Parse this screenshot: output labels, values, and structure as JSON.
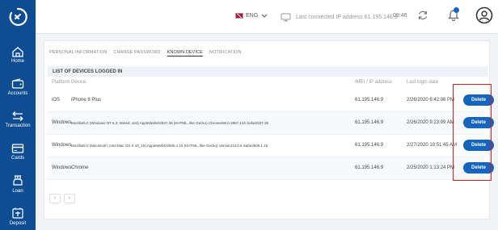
{
  "sidebar": {
    "items": [
      {
        "label": "Home",
        "icon": "home-icon"
      },
      {
        "label": "Accounts",
        "icon": "wallet-icon"
      },
      {
        "label": "Transaction",
        "icon": "transfer-icon"
      },
      {
        "label": "Cards",
        "icon": "card-icon"
      },
      {
        "label": "Loan",
        "icon": "loan-icon"
      },
      {
        "label": "Deposit",
        "icon": "deposit-icon"
      }
    ]
  },
  "header": {
    "language": "ENG",
    "last_connected_label": "Last connected IP address",
    "last_connected_ip": "61.195.146.9",
    "time": "09:46"
  },
  "tabs": [
    "PERSONAL INFORMATION",
    "CHANGE PASSWORD",
    "KNOWN DEVICE",
    "NOTIFICATION"
  ],
  "active_tab": "KNOWN DEVICE",
  "table": {
    "title": "LIST OF DEVICES LOGGED IN",
    "headers": [
      "Platform",
      "Device",
      "IMEI / IP address",
      "Last login date"
    ],
    "rows": [
      {
        "platform": "iOS",
        "device": "iPhone 8 Plus",
        "ip": "61.195.146.9",
        "last_login": "2/26/2020 6:42:08 PM",
        "action": "Delete"
      },
      {
        "platform": "Windows",
        "device": "Mozilla/5.0 (Windows NT 6.3; Win64; x64) AppleWebKit/537.36 (KHTML, like Gecko) Chrome/80.0.3987.122 Safari/537.36",
        "ip": "61.195.146.9",
        "last_login": "2/26/2020 9:23:09 AM",
        "action": "Delete"
      },
      {
        "platform": "Windows",
        "device": "Mozilla/5.0 (Macintosh; Intel Mac OS X 10_15) AppleWebKit/605.1.15 (KHTML, like Gecko) Version/13.0.5 Safari/605.1.15",
        "ip": "61.195.146.9",
        "last_login": "2/27/2020 10:51:45 AM",
        "action": "Delete"
      },
      {
        "platform": "Windows",
        "device": "Chrome",
        "ip": "61.195.146.9",
        "last_login": "2/25/2020 1:13:24 PM",
        "action": "Delete"
      }
    ]
  },
  "pagination": {
    "prev": "‹",
    "next": "›"
  },
  "colors": {
    "sidebar": "#0e4d92",
    "accent": "#1565c0",
    "highlight": "#d01e1e"
  }
}
